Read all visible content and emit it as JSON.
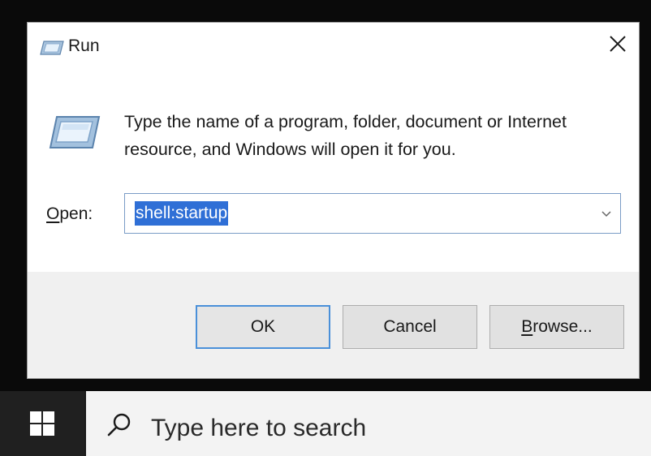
{
  "dialog": {
    "title": "Run",
    "close_label": "✕",
    "instruction": "Type the name of a program, folder, document or Internet resource, and Windows will open it for you.",
    "open_label_key": "O",
    "open_label_rest": "pen:",
    "open_value": "shell:startup",
    "buttons": {
      "ok": "OK",
      "cancel": "Cancel",
      "browse_key": "B",
      "browse_rest": "rowse..."
    }
  },
  "taskbar": {
    "search_placeholder": "Type here to search"
  },
  "icons": {
    "title": "run-icon",
    "large": "run-icon",
    "close": "close-icon",
    "combo": "chevron-down-icon",
    "start": "windows-logo-icon",
    "search": "search-icon"
  },
  "colors": {
    "selection": "#2f6fd6",
    "default_button_border": "#4a90d9",
    "button_area": "#f0f0f0",
    "taskbar": "#1b1b1b"
  }
}
